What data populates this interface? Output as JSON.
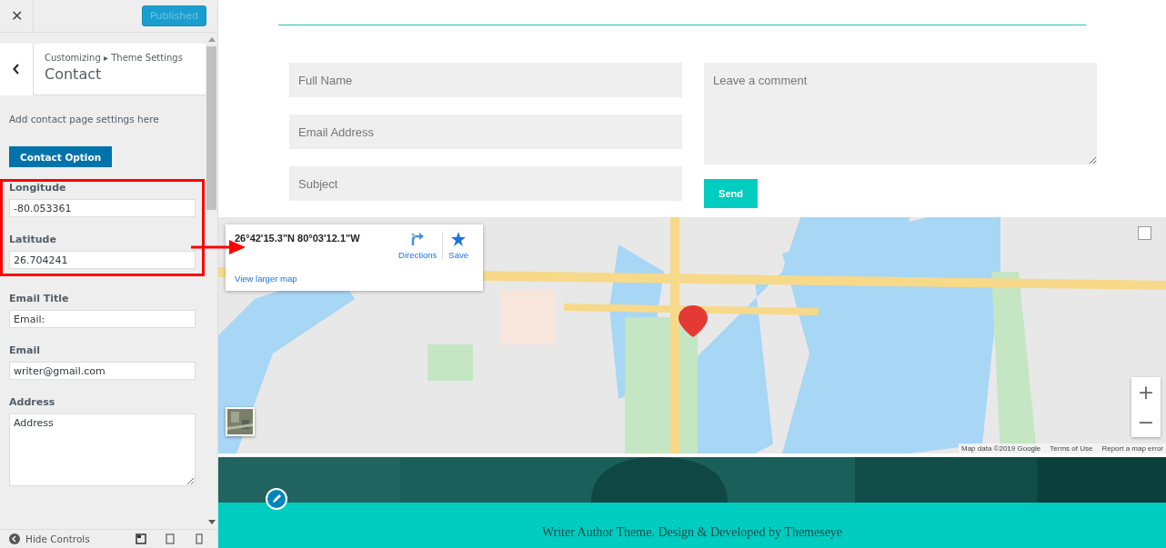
{
  "topbar": {
    "close": "✕",
    "publish_button": {
      "label": "Published",
      "disabled": true
    }
  },
  "header": {
    "breadcrumb": "Customizing ▸ Theme Settings",
    "title": "Contact"
  },
  "description": "Add contact page settings here",
  "section_button": "Contact Option",
  "settings": [
    {
      "label": "Longitude",
      "value": "-80.053361",
      "kind": "text",
      "highlighted": true
    },
    {
      "label": "Latitude",
      "value": "26.704241",
      "kind": "text",
      "highlighted": true
    },
    {
      "label": "Email Title",
      "value": "Email:",
      "kind": "text",
      "highlighted": false
    },
    {
      "label": "Email",
      "value": "writer@gmail.com",
      "kind": "text",
      "highlighted": false
    },
    {
      "label": "Address",
      "value": "Address",
      "kind": "textarea",
      "highlighted": false
    }
  ],
  "footer_controls": {
    "label": "Hide Controls"
  },
  "form": {
    "fields": [
      {
        "placeholder": "Full Name"
      },
      {
        "placeholder": "Email Address"
      },
      {
        "placeholder": "Subject"
      }
    ],
    "message": {
      "placeholder": "Leave a comment"
    },
    "send_button": "Send"
  },
  "map": {
    "info": {
      "coordinates": "26°42'15.3\"N 80°03'12.1\"W",
      "actions": [
        {
          "label": "Directions",
          "kind": "directions"
        },
        {
          "label": "Save",
          "kind": "save"
        }
      ],
      "link": "View larger map"
    },
    "zoom": [
      "+",
      "−"
    ],
    "overlay_toggle": {
      "checked": false
    },
    "attribution": [
      "Map data ©2019 Google",
      "Terms of Use",
      "Report a map error"
    ]
  },
  "footer": {
    "credit": "Writer Author Theme. Design & Developed by Themeseye"
  }
}
